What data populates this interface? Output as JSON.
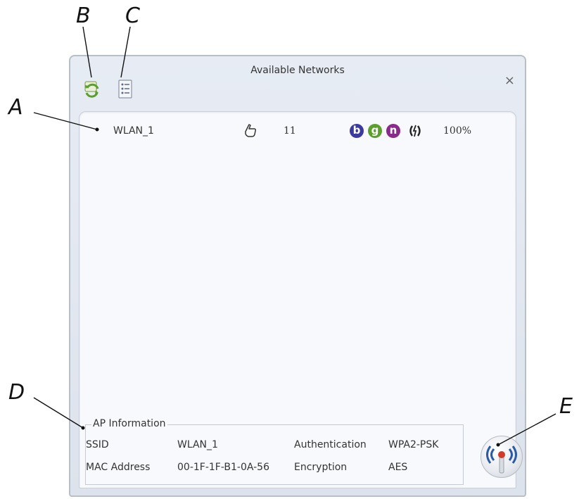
{
  "callouts": {
    "a": "A",
    "b": "B",
    "c": "C",
    "d": "D",
    "e": "E"
  },
  "window": {
    "title": "Available Networks",
    "close_glyph": "×"
  },
  "toolbar": {
    "refresh": {
      "icon": "refresh-icon"
    },
    "list": {
      "icon": "list-icon"
    }
  },
  "networks": [
    {
      "ssid": "WLAN_1",
      "type_icon": "hand-pointer-icon",
      "channel": "11",
      "modes": [
        {
          "label": "b",
          "color": "#3a3aa0"
        },
        {
          "label": "g",
          "color": "#5aa02a"
        },
        {
          "label": "n",
          "color": "#8a2a8a"
        }
      ],
      "security_icon": "secure-link-icon",
      "signal": "100%"
    }
  ],
  "ap_info": {
    "title": "AP Information",
    "ssid_label": "SSID",
    "ssid_value": "WLAN_1",
    "mac_label": "MAC Address",
    "mac_value": "00-1F-1F-B1-0A-56",
    "auth_label": "Authentication",
    "auth_value": "WPA2-PSK",
    "enc_label": "Encryption",
    "enc_value": "AES"
  },
  "connect_button": {
    "icon": "antenna-signal-icon"
  }
}
